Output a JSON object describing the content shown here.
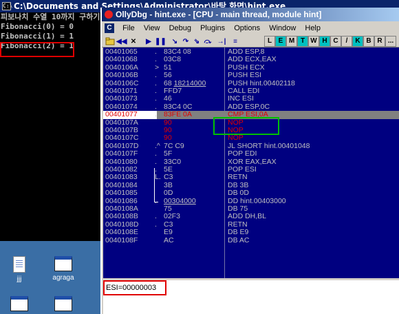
{
  "console": {
    "title": "C:\\Documents and Settings\\Administrator\\바탕 화면\\hint.exe",
    "icon_label": "C:\\",
    "lines": [
      "피보나치 수열 10까지 구하기",
      "Fibonacci(0) = 0",
      "Fibonacci(1) = 1",
      "Fibonacci(2) = 1"
    ]
  },
  "desktop": {
    "icons": [
      {
        "label": "jjj",
        "icon": "document-icon"
      },
      {
        "label": "agraga",
        "icon": "window-icon"
      },
      {
        "label": "",
        "icon": "window-icon"
      },
      {
        "label": "",
        "icon": "window-icon"
      }
    ]
  },
  "olly": {
    "title": "OllyDbg - hint.exe - [CPU - main thread, module hint]",
    "menu_icon": "C",
    "menu": [
      "File",
      "View",
      "Debug",
      "Plugins",
      "Options",
      "Window",
      "Help"
    ],
    "toolbar": {
      "buttons": [
        "open-icon",
        "rewind-icon",
        "close-icon",
        "run-icon",
        "pause-icon",
        "step-into-icon",
        "step-over-icon",
        "trace-into-icon",
        "trace-over-icon",
        "execute-till-return-icon",
        "goto-icon"
      ],
      "letters": [
        "L",
        "E",
        "M",
        "T",
        "W",
        "H",
        "C",
        "/",
        "K",
        "B",
        "R",
        "..."
      ]
    },
    "rows": [
      {
        "addr": "00401065",
        "mark": ".",
        "hex": "83C4 08",
        "dis": "ADD ESP,8"
      },
      {
        "addr": "00401068",
        "mark": ".",
        "hex": "03C8",
        "dis": "ADD ECX,EAX"
      },
      {
        "addr": "0040106A",
        "mark": ">",
        "hex": "51",
        "dis": "PUSH ECX"
      },
      {
        "addr": "0040106B",
        "mark": ".",
        "hex": "56",
        "dis": "PUSH ESI"
      },
      {
        "addr": "0040106C",
        "mark": ".",
        "hex": "68 18214000",
        "hex_u": "18214000",
        "dis": "PUSH hint.00402118"
      },
      {
        "addr": "00401071",
        "mark": ".",
        "hex": "FFD7",
        "dis": "CALL EDI"
      },
      {
        "addr": "00401073",
        "mark": ".",
        "hex": "46",
        "dis": "INC ESI"
      },
      {
        "addr": "00401074",
        "mark": ".",
        "hex": "83C4 0C",
        "dis": "ADD ESP,0C"
      },
      {
        "addr": "00401077",
        "mark": ".",
        "hex": "83FE 0A",
        "dis": "CMP ESI,0A",
        "state": "current"
      },
      {
        "addr": "0040107A",
        "mark": "",
        "hex": "90",
        "dis": "NOP",
        "state": "red"
      },
      {
        "addr": "0040107B",
        "mark": "",
        "hex": "90",
        "dis": "NOP",
        "state": "red"
      },
      {
        "addr": "0040107C",
        "mark": "",
        "hex": "90",
        "dis": "NOP",
        "state": "red"
      },
      {
        "addr": "0040107D",
        "mark": ".^",
        "hex": "7C C9",
        "dis": "JL SHORT hint.00401048"
      },
      {
        "addr": "0040107F",
        "mark": ".",
        "hex": "5F",
        "dis": "POP EDI"
      },
      {
        "addr": "00401080",
        "mark": ".",
        "hex": "33C0",
        "dis": "XOR EAX,EAX"
      },
      {
        "addr": "00401082",
        "mark": ".",
        "hex": "5E",
        "dis": "POP ESI"
      },
      {
        "addr": "00401083",
        "mark": "L.",
        "hex": "C3",
        "dis": "RETN"
      },
      {
        "addr": "00401084",
        "mark": "",
        "hex": "3B",
        "dis": "DB 3B"
      },
      {
        "addr": "00401085",
        "mark": "",
        "hex": "0D",
        "dis": "DB 0D"
      },
      {
        "addr": "00401086",
        "mark": ".",
        "hex": "00304000",
        "hex_u": "00304000",
        "dis": "DD hint.00403000"
      },
      {
        "addr": "0040108A",
        "mark": "",
        "hex": "75",
        "dis": "DB 75"
      },
      {
        "addr": "0040108B",
        "mark": ".",
        "hex": "02F3",
        "dis": "ADD DH,BL"
      },
      {
        "addr": "0040108D",
        "mark": ".",
        "hex": "C3",
        "dis": "RETN"
      },
      {
        "addr": "0040108E",
        "mark": "",
        "hex": "E9",
        "dis": "DB E9"
      },
      {
        "addr": "0040108F",
        "mark": "",
        "hex": "AC",
        "dis": "DB AC"
      }
    ],
    "info": "ESI=00000003"
  },
  "colors": {
    "cpu_background": "#000080",
    "highlight_red": "#e00000",
    "annotation_red": "#e00000",
    "annotation_green": "#00c000"
  }
}
